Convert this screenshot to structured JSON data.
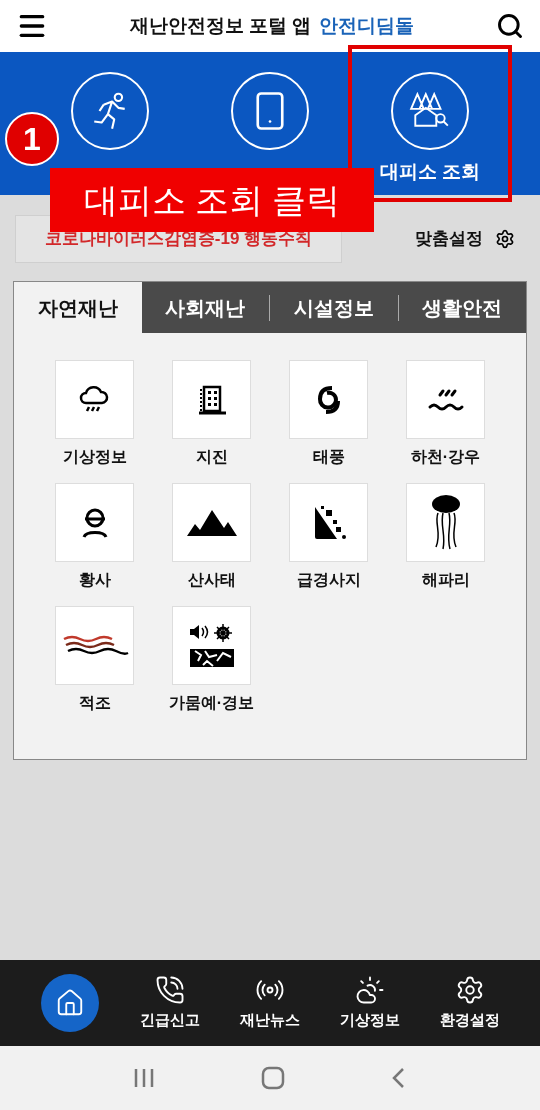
{
  "header": {
    "title": "재난안전정보 포털 앱",
    "brand": "안전디딤돌"
  },
  "quick_menu": [
    {
      "highlighted": false
    },
    {
      "highlighted": false
    },
    {
      "label": "대피소 조회",
      "highlighted": true
    }
  ],
  "annotation": {
    "badge": "1",
    "text": "대피소 조회 클릭"
  },
  "notice_button": "코로나바이러스감염증-19 행동수칙",
  "custom_settings": "맞춤설정",
  "tabs": [
    {
      "label": "자연재난",
      "selected": true
    },
    {
      "label": "사회재난",
      "selected": false
    },
    {
      "label": "시설정보",
      "selected": false
    },
    {
      "label": "생활안전",
      "selected": false
    }
  ],
  "disasters": [
    {
      "label": "기상정보"
    },
    {
      "label": "지진"
    },
    {
      "label": "태풍"
    },
    {
      "label": "하천·강우"
    },
    {
      "label": "황사"
    },
    {
      "label": "산사태"
    },
    {
      "label": "급경사지"
    },
    {
      "label": "해파리"
    },
    {
      "label": "적조"
    },
    {
      "label": "가뭄예·경보"
    }
  ],
  "bottom_nav": [
    {
      "selected": true
    },
    {
      "label": "긴급신고",
      "selected": false
    },
    {
      "label": "재난뉴스",
      "selected": false
    },
    {
      "label": "기상정보",
      "selected": false
    },
    {
      "label": "환경설정",
      "selected": false
    }
  ]
}
